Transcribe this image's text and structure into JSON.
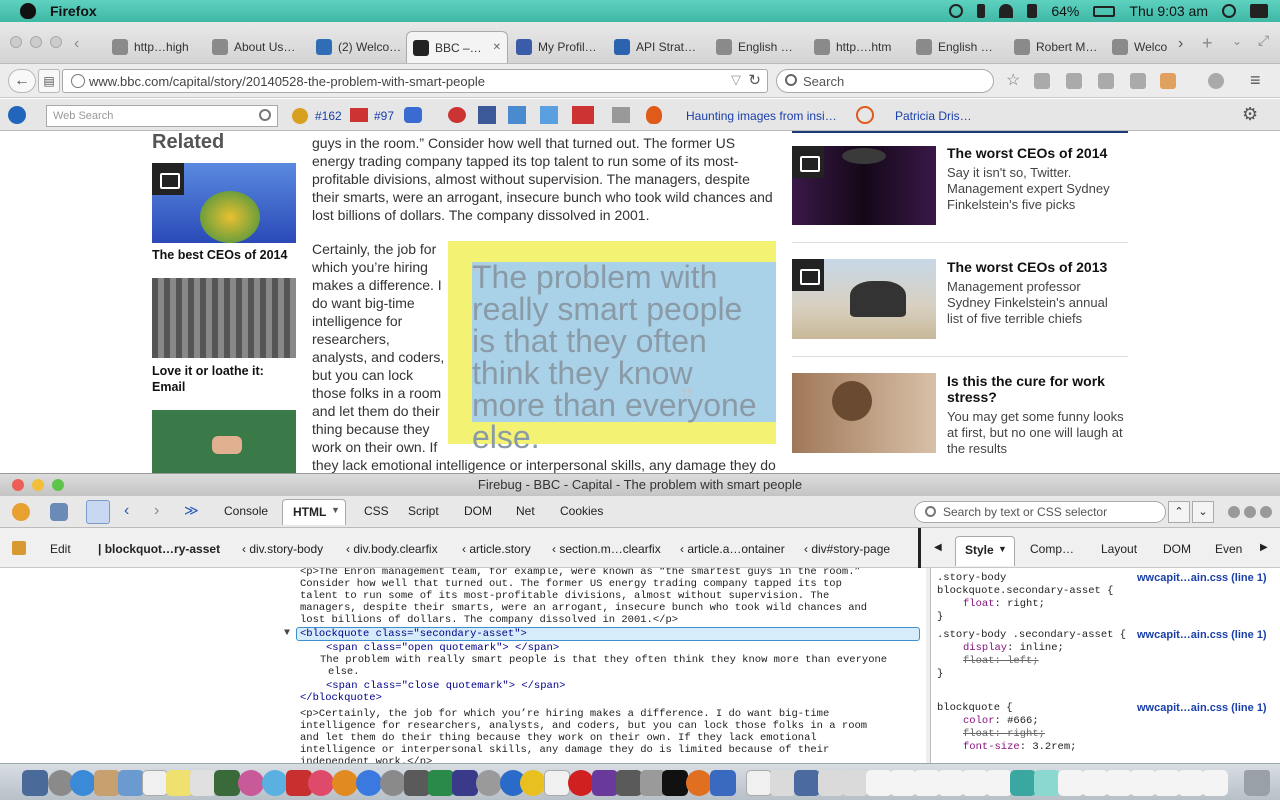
{
  "menubar": {
    "app": "Firefox",
    "battery": "64%",
    "clock": "Thu 9:03 am"
  },
  "tabs": [
    {
      "label": "http…high",
      "color": "#8a8a8a"
    },
    {
      "label": "About Us…",
      "color": "#8a8a8a"
    },
    {
      "label": "(2) Welco…",
      "color": "#2f6db5"
    },
    {
      "label": "BBC –…",
      "color": "#222222",
      "active": true
    },
    {
      "label": "My Profil…",
      "color": "#3b5ca8"
    },
    {
      "label": "API Strat…",
      "color": "#2c63b0"
    },
    {
      "label": "English …",
      "color": "#8a8a8a"
    },
    {
      "label": "http….htm",
      "color": "#8a8a8a"
    },
    {
      "label": "English …",
      "color": "#8a8a8a"
    },
    {
      "label": "Robert M…",
      "color": "#8a8a8a"
    },
    {
      "label": "Welco",
      "color": "#8a8a8a"
    }
  ],
  "nav": {
    "url": "www.bbc.com/capital/story/20140528-the-problem-with-smart-people",
    "search_placeholder": "Search"
  },
  "bookmarks": {
    "websearch_placeholder": "Web Search",
    "badge1": "#162",
    "badge2": "#97",
    "link1": "Haunting images from insi…",
    "link2": "Patricia Dris…"
  },
  "related": {
    "heading": "Related",
    "items": [
      {
        "title": "The best CEOs of 2014"
      },
      {
        "title": "Love it or loathe it: Email"
      }
    ]
  },
  "article": {
    "para1": "guys in the room.” Consider how well that turned out. The former US energy trading company tapped its top talent to run some of its most-profitable divisions, almost without supervision. The managers, despite their smarts, were an arrogant, insecure bunch who took wild chances and lost billions of dollars. The company dissolved in 2001.",
    "para2_lines": [
      "Certainly, the job for",
      "which you’re hiring",
      "makes a difference. I",
      "do want big-time",
      "intelligence for",
      "researchers,",
      "analysts, and coders,",
      "but you can lock",
      "those folks in a room",
      "and let them do their",
      "thing because they",
      "work on their own. If"
    ],
    "para2_tail": "they lack emotional intelligence or interpersonal skills, any damage they do",
    "pullquote": "The problem with really smart people is that they often think they know more than everyone else."
  },
  "right_stories": [
    {
      "title": "The worst CEOs of 2014",
      "desc": "Say it isn't so, Twitter. Management expert Sydney Finkelstein's five picks"
    },
    {
      "title": "The worst CEOs of 2013",
      "desc": "Management professor Sydney Finkelstein's annual list of five terrible chiefs"
    },
    {
      "title": "Is this the cure for work stress?",
      "desc": "You may get some funny looks at first, but no one will laugh at the results"
    }
  ],
  "firebug": {
    "title": "Firebug - BBC - Capital - The problem with smart people",
    "tabs": [
      "Console",
      "HTML",
      "CSS",
      "Script",
      "DOM",
      "Net",
      "Cookies"
    ],
    "search_placeholder": "Search by text or CSS selector",
    "edit": "Edit",
    "crumbs": [
      "blockquot…ry-asset",
      "div.story-body",
      "div.body.clearfix",
      "article.story",
      "section.m…clearfix",
      "article.a…ontainer",
      "div#story-page"
    ],
    "side_tabs": [
      "Style",
      "Comp…",
      "Layout",
      "DOM",
      "Even"
    ],
    "html_lines": [
      "<p>The Enron management team, for example, were known as “the smartest guys in the room.”",
      " Consider how well that turned out. The former US energy trading company tapped its top",
      "talent to run some of its most-profitable divisions, almost without supervision. The",
      "managers, despite their smarts, were an arrogant, insecure bunch who took wild chances and",
      "lost billions of dollars. The company dissolved in 2001.</p>"
    ],
    "bq_open": "<blockquote class=\"secondary-asset\">",
    "bq_span1": "<span class=\"open quotemark\"> </span>",
    "bq_text1": "The problem with really smart people is that they often think they know more than everyone",
    "bq_text2": "else.",
    "bq_span2": "<span class=\"close quotemark\"> </span>",
    "bq_close": "</blockquote>",
    "html_lines2": [
      "<p>Certainly, the job for which you’re hiring makes a difference. I do want big-time",
      "intelligence for researchers, analysts, and coders, but you can lock those folks in a room",
      "and let them do their thing because they work on their own. If they lack emotional",
      "intelligence or interpersonal skills, any damage they do is limited because of their",
      "independent work.</p>"
    ],
    "css_rules": [
      {
        "selector": ".story-body blockquote.secondary-asset {",
        "source": "wwcapit…ain.css (line 1)",
        "props": [
          {
            "name": "float",
            "value": "right;",
            "struck": false
          }
        ]
      },
      {
        "selector": ".story-body .secondary-asset {",
        "source": "wwcapit…ain.css (line 1)",
        "props": [
          {
            "name": "display",
            "value": "inline;",
            "struck": false
          },
          {
            "name": "float",
            "value": "left;",
            "struck": true
          }
        ]
      },
      {
        "selector": "blockquote {",
        "source": "wwcapit…ain.css (line 1)",
        "props": [
          {
            "name": "color",
            "value": "#666;",
            "struck": false
          },
          {
            "name": "float",
            "value": "right;",
            "struck": true
          },
          {
            "name": "font-size",
            "value": "3.2rem;",
            "struck": false
          }
        ]
      }
    ]
  }
}
